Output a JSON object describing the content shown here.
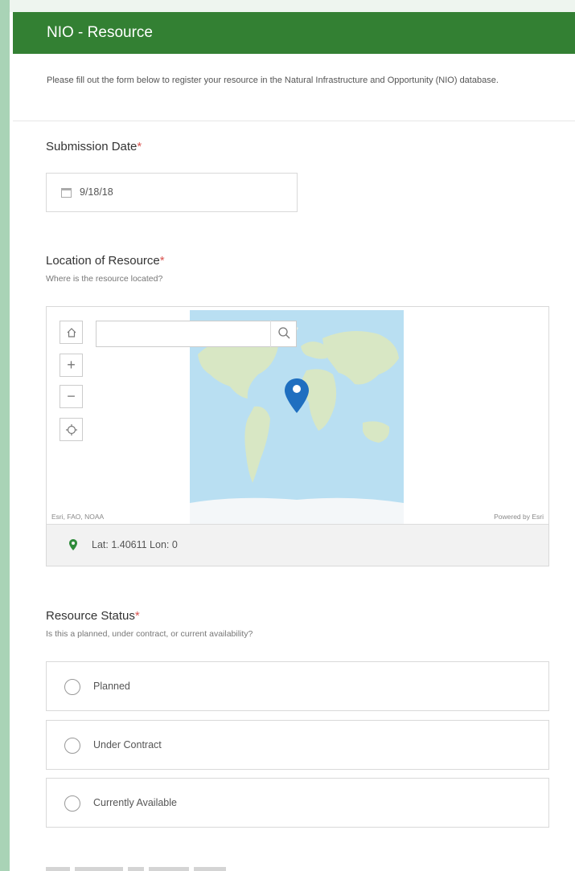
{
  "header": {
    "title": "NIO - Resource"
  },
  "intro": {
    "text": "Please fill out the form below to register your resource in the Natural Infrastructure and Opportunity (NIO) database."
  },
  "submission_date": {
    "label": "Submission Date",
    "required_mark": "*",
    "value": "9/18/18"
  },
  "location": {
    "label": "Location of Resource",
    "required_mark": "*",
    "description": "Where is the resource located?",
    "search": {
      "value": "",
      "placeholder": ""
    },
    "attribution_left": "Esri, FAO, NOAA",
    "attribution_right": "Powered by Esri",
    "coordinates": "Lat: 1.40611  Lon: 0",
    "controls": [
      "home-icon",
      "zoom-in-icon",
      "zoom-out-icon",
      "locate-icon",
      "search-icon"
    ]
  },
  "resource_status": {
    "label": "Resource Status",
    "required_mark": "*",
    "description": "Is this a planned, under contract, or current availability?",
    "options": [
      {
        "label": "Planned",
        "selected": false
      },
      {
        "label": "Under Contract",
        "selected": false
      },
      {
        "label": "Currently Available",
        "selected": false
      }
    ]
  },
  "colors": {
    "header_green": "#338033",
    "required_red": "#d9534f",
    "map_ocean": "#b9dff2",
    "map_land": "#d8e7c4",
    "map_pin": "#1f6fc0",
    "coord_pin": "#2e8b3a"
  }
}
